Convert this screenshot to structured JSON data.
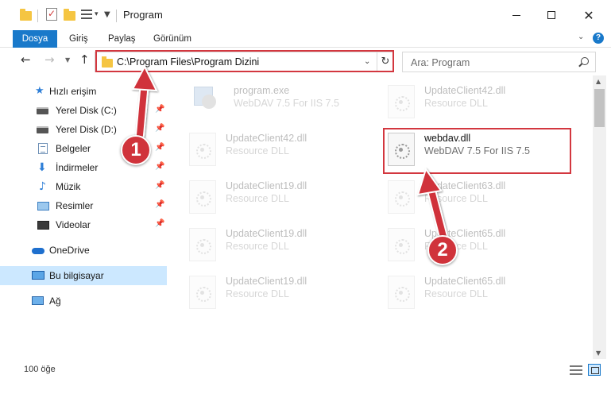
{
  "window": {
    "title": "Program",
    "min_icon": "minimize-icon",
    "max_icon": "maximize-icon",
    "close_icon": "close-icon"
  },
  "ribbon": {
    "tabs": [
      {
        "label": "Dosya",
        "active": true
      },
      {
        "label": "Giriş"
      },
      {
        "label": "Paylaş"
      },
      {
        "label": "Görünüm"
      }
    ],
    "help_label": "?"
  },
  "address": {
    "path": "C:\\Program Files\\Program Dizini",
    "search_placeholder": "Ara: Program"
  },
  "sidebar": {
    "items": [
      {
        "label": "Hızlı erişim",
        "icon": "star-icon"
      },
      {
        "label": "Yerel Disk (C:)",
        "icon": "disk-icon",
        "pinned": true
      },
      {
        "label": "Yerel Disk (D:)",
        "icon": "disk-icon",
        "pinned": true
      },
      {
        "label": "Belgeler",
        "icon": "documents-icon",
        "pinned": true
      },
      {
        "label": "İndirmeler",
        "icon": "download-icon",
        "pinned": true
      },
      {
        "label": "Müzik",
        "icon": "music-icon",
        "pinned": true
      },
      {
        "label": "Resimler",
        "icon": "pictures-icon",
        "pinned": true
      },
      {
        "label": "Videolar",
        "icon": "videos-icon",
        "pinned": true
      },
      {
        "label": "OneDrive",
        "icon": "cloud-icon"
      },
      {
        "label": "Bu bilgisayar",
        "icon": "computer-icon",
        "selected": true
      },
      {
        "label": "Ağ",
        "icon": "network-icon"
      }
    ]
  },
  "files": [
    {
      "name": "program.exe",
      "desc": "WebDAV 7.5 For IIS 7.5",
      "faded": true
    },
    {
      "name": "UpdateClient42.dll",
      "desc": "Resource DLL",
      "faded": true
    },
    {
      "name": "UpdateClient42.dll",
      "desc": "Resource DLL",
      "faded": true
    },
    {
      "name": "webdav.dll",
      "desc": "WebDAV 7.5 For IIS 7.5",
      "faded": false
    },
    {
      "name": "UpdateClient19.dll",
      "desc": "Resource DLL",
      "faded": true
    },
    {
      "name": "UpdateClient63.dll",
      "desc": "Resource DLL",
      "faded": true
    },
    {
      "name": "UpdateClient19.dll",
      "desc": "Resource DLL",
      "faded": true
    },
    {
      "name": "UpdateClient65.dll",
      "desc": "Resource DLL",
      "faded": true
    },
    {
      "name": "UpdateClient19.dll",
      "desc": "Resource DLL",
      "faded": true
    },
    {
      "name": "UpdateClient65.dll",
      "desc": "Resource DLL",
      "faded": true
    }
  ],
  "status": {
    "item_count": "100 öğe"
  },
  "annotations": {
    "step1": "1",
    "step2": "2",
    "color": "#d0333b"
  },
  "colors": {
    "accent": "#1979ca",
    "selection": "#cce8ff",
    "highlight_box": "#d3373f"
  }
}
